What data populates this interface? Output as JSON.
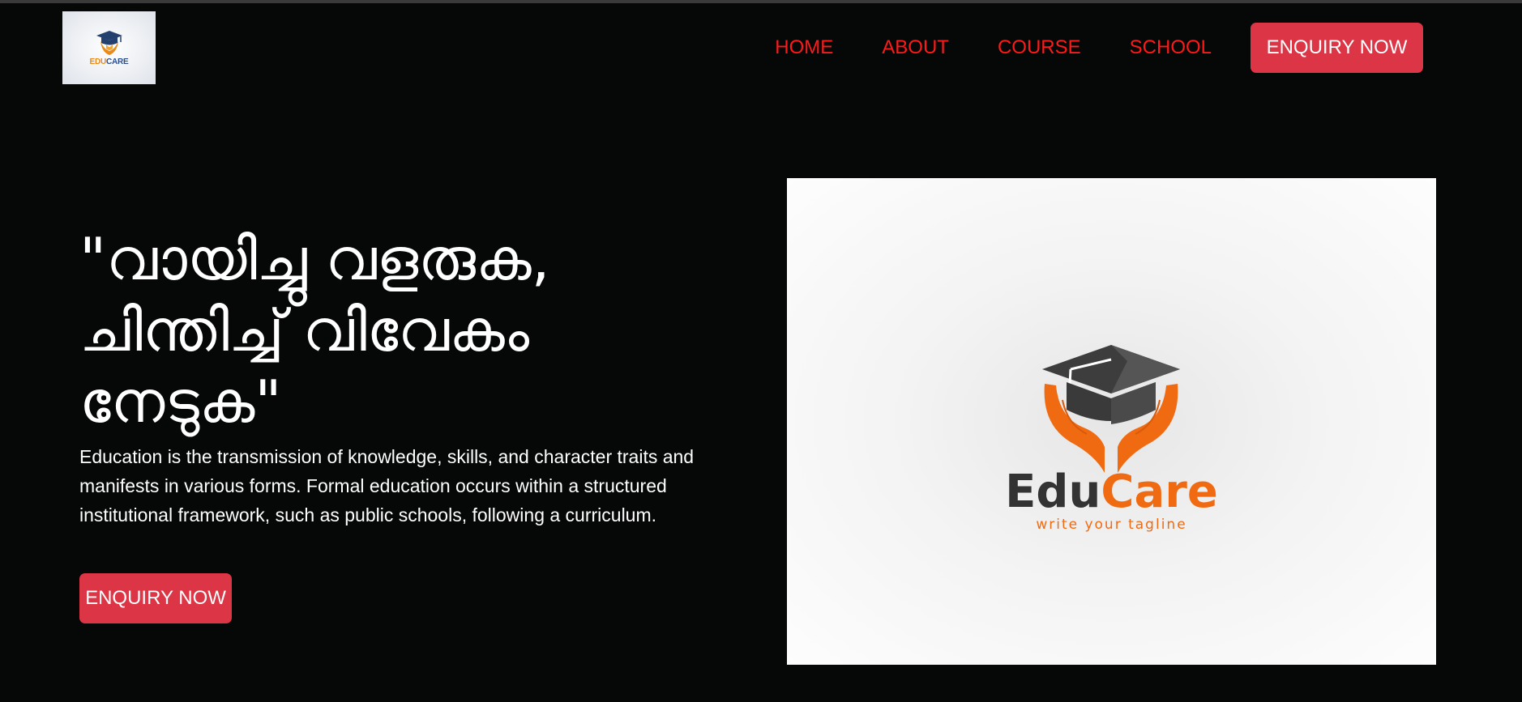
{
  "header": {
    "logo": {
      "edu": "EDU",
      "care": "CARE"
    },
    "nav": [
      {
        "label": "HOME"
      },
      {
        "label": "ABOUT"
      },
      {
        "label": "COURSE"
      },
      {
        "label": "SCHOOL"
      }
    ],
    "cta_label": "ENQUIRY NOW"
  },
  "hero": {
    "title_line1": "\"വായിച്ചു വളരുക,",
    "title_line2": "ചിന്തിച്ച് വിവേകം",
    "title_line3": "നേടുക\"",
    "description": "Education is the transmission of knowledge, skills, and character traits and manifests in various forms. Formal education occurs within a structured institutional framework, such as public schools, following a curriculum.",
    "cta_label": "ENQUIRY NOW",
    "image": {
      "brand_edu": "Edu",
      "brand_care": "Care",
      "tagline": "write your tagline"
    }
  },
  "colors": {
    "background": "#060707",
    "nav_link": "#ff1a1a",
    "button": "#dc3545",
    "brand_orange": "#f06a12",
    "brand_dark": "#333333"
  }
}
